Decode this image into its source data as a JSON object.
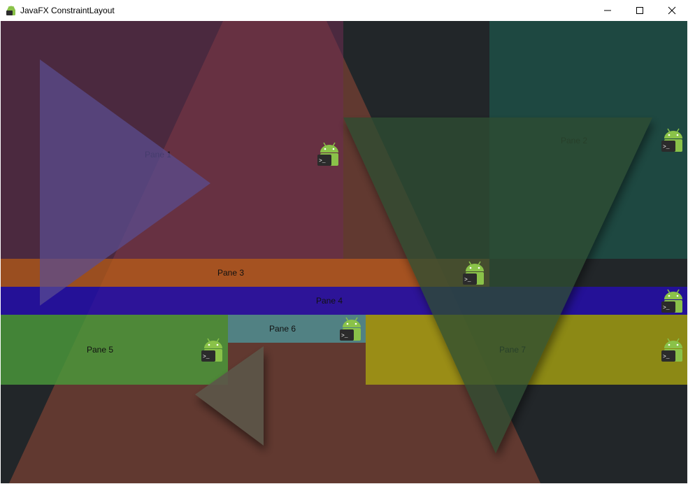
{
  "window": {
    "title": "JavaFX ConstraintLayout",
    "icon": "android-terminal-icon",
    "controls": [
      "minimize-icon",
      "maximize-icon",
      "close-icon"
    ]
  },
  "panes": [
    {
      "id": "pane-1",
      "label": "Pane 1",
      "color": "#6e2b52"
    },
    {
      "id": "pane-2",
      "label": "Pane 2",
      "color": "#1d4a45"
    },
    {
      "id": "pane-3",
      "label": "Pane 3",
      "color": "#b5581f"
    },
    {
      "id": "pane-4",
      "label": "Pane 4",
      "color": "#2a15a6"
    },
    {
      "id": "pane-5",
      "label": "Pane 5",
      "color": "#4a9a3a"
    },
    {
      "id": "pane-6",
      "label": "Pane 6",
      "color": "#3d8a8e"
    },
    {
      "id": "pane-7",
      "label": "Pane 7",
      "color": "#9e9a14"
    }
  ],
  "colors": {
    "background": "#222629",
    "big_triangle": "#c85a3c",
    "purple_triangle": "#5a4a8a",
    "green_triangle": "#2d4a30",
    "small_triangle": "#5a5448",
    "android_green": "#8ac249",
    "terminal_dark": "#2d2d2d"
  }
}
